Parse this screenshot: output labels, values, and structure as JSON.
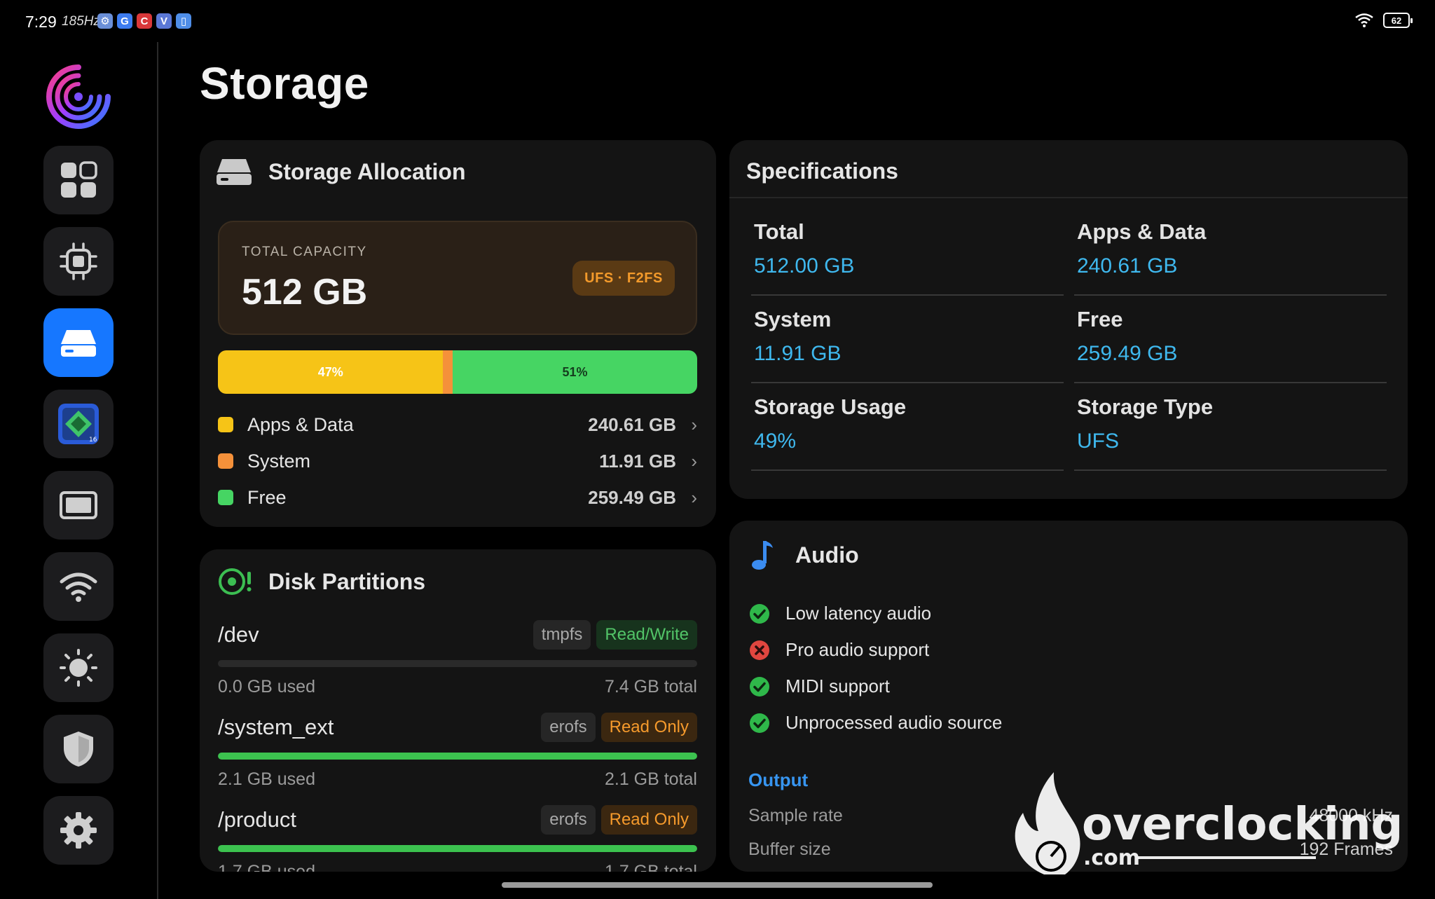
{
  "status_bar": {
    "time": "7:29",
    "refresh_rate": "185Hz",
    "battery": "62"
  },
  "sidebar": {
    "items": [
      {
        "name": "dashboard",
        "icon": "grid-icon",
        "active": false
      },
      {
        "name": "cpu",
        "icon": "cpu-icon",
        "active": false
      },
      {
        "name": "storage",
        "icon": "drive-icon",
        "active": true
      },
      {
        "name": "android",
        "icon": "android-chip-icon",
        "active": false
      },
      {
        "name": "display",
        "icon": "display-icon",
        "active": false
      },
      {
        "name": "network",
        "icon": "wifi-icon",
        "active": false
      },
      {
        "name": "sensors",
        "icon": "sun-icon",
        "active": false
      },
      {
        "name": "security",
        "icon": "shield-icon",
        "active": false
      },
      {
        "name": "settings",
        "icon": "gear-icon",
        "active": false
      }
    ]
  },
  "page": {
    "title": "Storage"
  },
  "allocation": {
    "title": "Storage Allocation",
    "capacity_label": "TOTAL CAPACITY",
    "capacity_value": "512 GB",
    "fs_badge": "UFS · F2FS",
    "bar": {
      "apps_pct": 47,
      "system_pct": 2,
      "free_pct": 51,
      "apps_label": "47%",
      "free_label": "51%"
    },
    "legend": [
      {
        "name": "Apps & Data",
        "value": "240.61 GB",
        "color": "#f6c417"
      },
      {
        "name": "System",
        "value": "11.91 GB",
        "color": "#f5913a"
      },
      {
        "name": "Free",
        "value": "259.49 GB",
        "color": "#46d563"
      }
    ]
  },
  "partitions": {
    "title": "Disk Partitions",
    "items": [
      {
        "mount": "/dev",
        "fs": "tmpfs",
        "mode": "Read/Write",
        "used": "0.0 GB used",
        "total": "7.4 GB total",
        "fill": 0
      },
      {
        "mount": "/system_ext",
        "fs": "erofs",
        "mode": "Read Only",
        "used": "2.1 GB used",
        "total": "2.1 GB total",
        "fill": 1
      },
      {
        "mount": "/product",
        "fs": "erofs",
        "mode": "Read Only",
        "used": "1.7 GB used",
        "total": "1.7 GB total",
        "fill": 1
      }
    ]
  },
  "specs": {
    "title": "Specifications",
    "items": [
      {
        "label": "Total",
        "value": "512.00 GB"
      },
      {
        "label": "Apps & Data",
        "value": "240.61 GB"
      },
      {
        "label": "System",
        "value": "11.91 GB"
      },
      {
        "label": "Free",
        "value": "259.49 GB"
      },
      {
        "label": "Storage Usage",
        "value": "49%"
      },
      {
        "label": "Storage Type",
        "value": "UFS"
      }
    ]
  },
  "audio": {
    "title": "Audio",
    "features": [
      {
        "label": "Low latency audio",
        "supported": true
      },
      {
        "label": "Pro audio support",
        "supported": false
      },
      {
        "label": "MIDI support",
        "supported": true
      },
      {
        "label": "Unprocessed audio source",
        "supported": true
      }
    ],
    "output_title": "Output",
    "output": [
      {
        "label": "Sample rate",
        "value": "48000 kHz"
      },
      {
        "label": "Buffer size",
        "value": "192 Frames"
      }
    ]
  },
  "watermark": {
    "brand": "overclocking",
    "suffix": ".com"
  },
  "colors": {
    "accent": "#1677ff",
    "value_blue": "#3fb8ee",
    "apps": "#f6c417",
    "system": "#f5913a",
    "free": "#46d563",
    "ok": "#2fb84a",
    "error": "#e0463f"
  }
}
